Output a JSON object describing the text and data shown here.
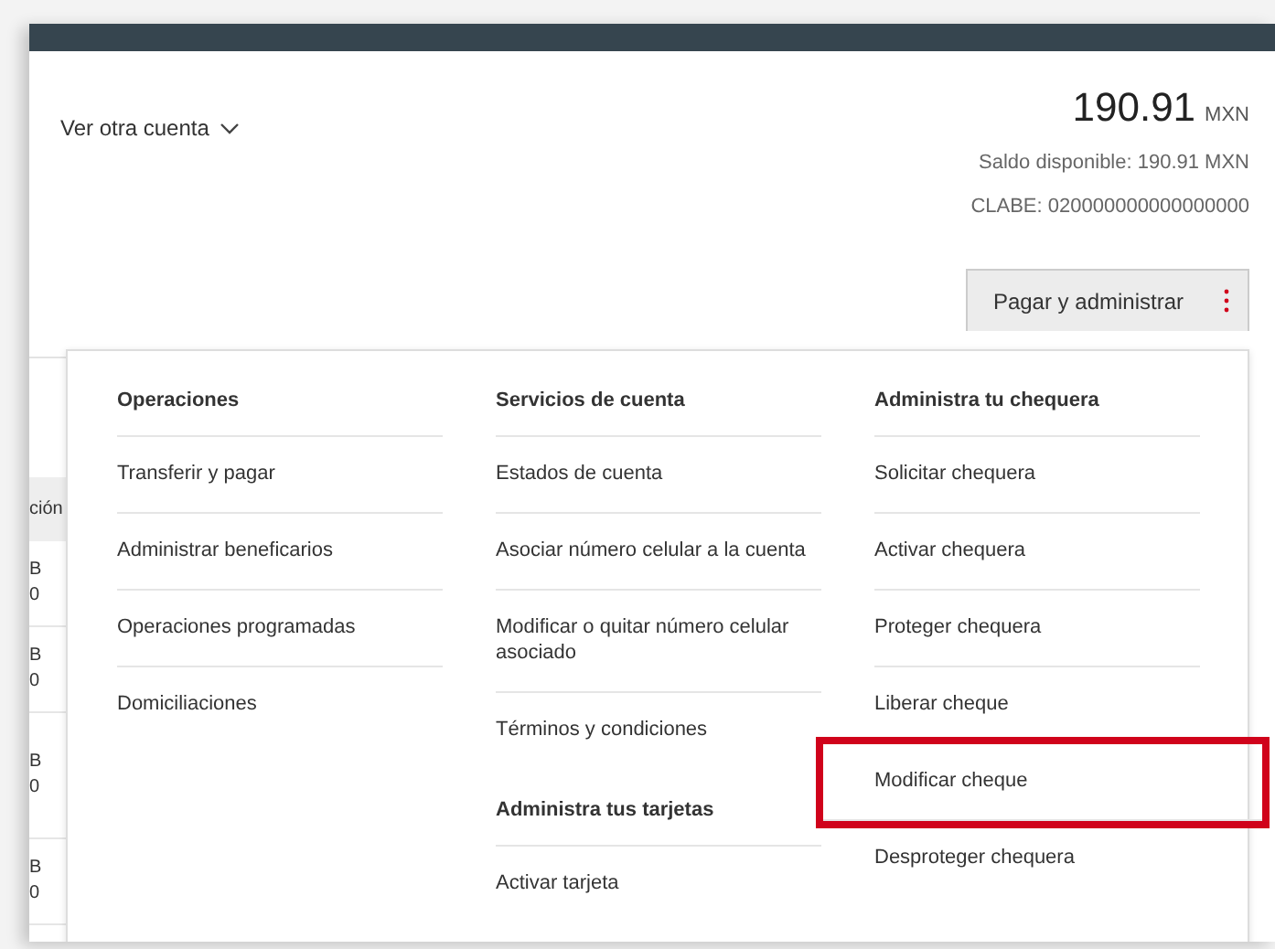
{
  "account_selector": {
    "label": "Ver otra cuenta"
  },
  "balance": {
    "amount": "190.91",
    "currency": "MXN",
    "available": "Saldo disponible: 190.91 MXN",
    "clabe": "CLABE: 020000000000000000"
  },
  "actions_button": {
    "label": "Pagar y administrar"
  },
  "background_table": {
    "header": "ción",
    "rows": [
      {
        "line_1": "B",
        "line_2": "0"
      },
      {
        "line_1": "B",
        "line_2": "0"
      },
      {
        "line_1": "B",
        "line_2": "0"
      },
      {
        "line_1": "B",
        "line_2": "0"
      }
    ]
  },
  "menu": {
    "columns": [
      {
        "sections": [
          {
            "heading": "Operaciones",
            "items": [
              {
                "label": "Transferir y pagar",
                "highlighted": false
              },
              {
                "label": "Administrar beneficarios",
                "highlighted": false
              },
              {
                "label": "Operaciones programadas",
                "highlighted": false
              },
              {
                "label": "Domiciliaciones",
                "highlighted": false
              }
            ]
          }
        ]
      },
      {
        "sections": [
          {
            "heading": "Servicios de cuenta",
            "items": [
              {
                "label": "Estados de cuenta",
                "highlighted": false
              },
              {
                "label": "Asociar número celular a la cuenta",
                "highlighted": false
              },
              {
                "label": "Modificar o quitar número celular asociado",
                "highlighted": false
              },
              {
                "label": "Términos y condiciones",
                "highlighted": false
              }
            ]
          },
          {
            "heading": "Administra tus tarjetas",
            "items": [
              {
                "label": "Activar tarjeta",
                "highlighted": false
              }
            ]
          }
        ]
      },
      {
        "sections": [
          {
            "heading": "Administra tu chequera",
            "items": [
              {
                "label": "Solicitar chequera",
                "highlighted": false
              },
              {
                "label": "Activar chequera",
                "highlighted": false
              },
              {
                "label": "Proteger chequera",
                "highlighted": false
              },
              {
                "label": "Liberar cheque",
                "highlighted": false
              },
              {
                "label": "Modificar cheque",
                "highlighted": true
              },
              {
                "label": "Desproteger chequera",
                "highlighted": false
              }
            ]
          }
        ]
      }
    ]
  }
}
